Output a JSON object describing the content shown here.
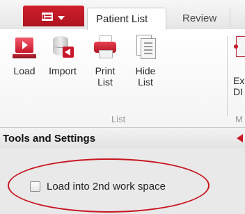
{
  "ribbon": {
    "app_menu_icon": "app-menu-icon",
    "tabs": [
      {
        "label": "Patient List",
        "active": true
      },
      {
        "label": "Review",
        "active": false
      }
    ],
    "buttons": [
      {
        "label": "Load",
        "icon": "load-icon"
      },
      {
        "label": "Import",
        "icon": "import-icon"
      },
      {
        "label": "Print\nList",
        "icon": "print-icon"
      },
      {
        "label": "Hide\nList",
        "icon": "hide-list-icon"
      },
      {
        "label": "Ex\nDI",
        "icon": "export-icon"
      }
    ],
    "groups": [
      {
        "label": "List"
      },
      {
        "label": "M"
      }
    ]
  },
  "tools_panel": {
    "title": "Tools and Settings",
    "checkbox": {
      "label": "Load into 2nd work space",
      "checked": false
    }
  },
  "colors": {
    "accent": "#c8172a",
    "highlight": "#c8151f"
  }
}
